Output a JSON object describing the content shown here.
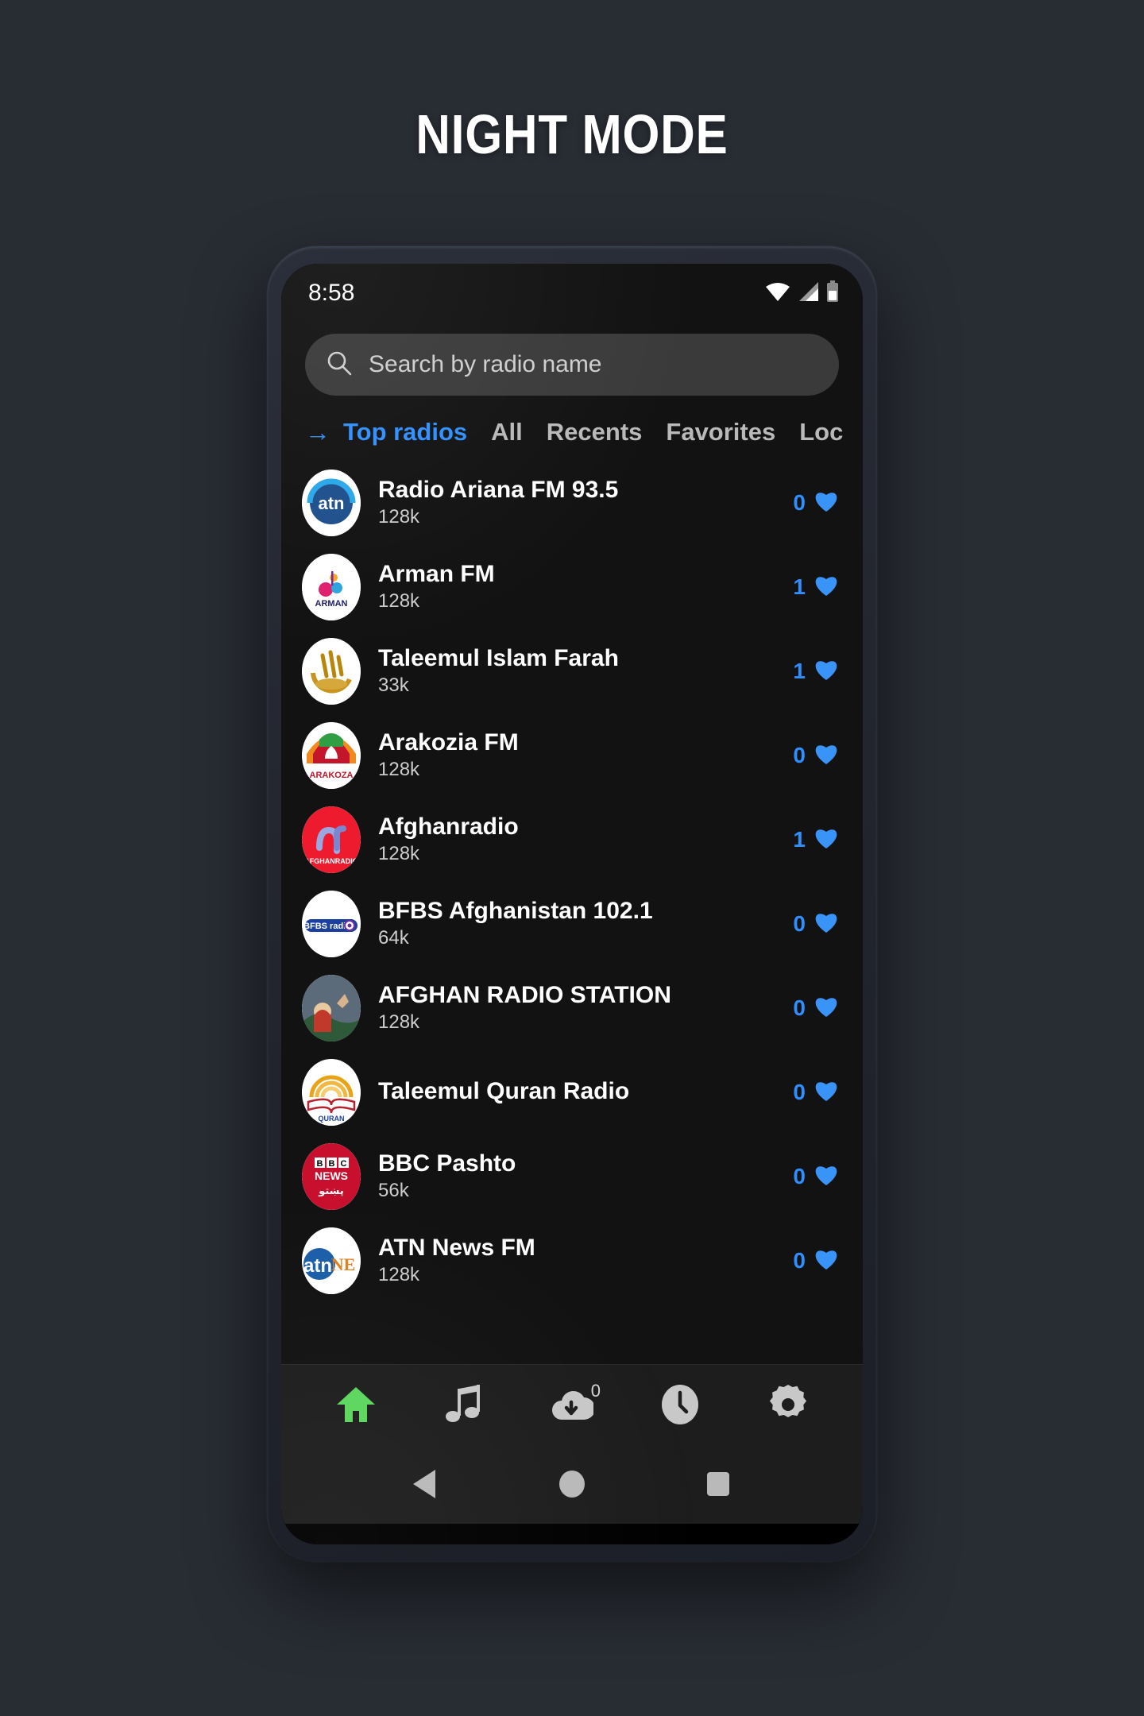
{
  "poster": {
    "title": "NIGHT MODE",
    "background_color": "#282c33"
  },
  "status_bar": {
    "time": "8:58",
    "icons": [
      "wifi-icon",
      "signal-icon",
      "battery-icon"
    ]
  },
  "search": {
    "placeholder": "Search by radio name",
    "icon": "search-icon"
  },
  "tabs": {
    "arrow_glyph": "→",
    "active_color": "#2f8fff",
    "items": [
      {
        "label": "Top radios",
        "active": true
      },
      {
        "label": "All",
        "active": false
      },
      {
        "label": "Recents",
        "active": false
      },
      {
        "label": "Favorites",
        "active": false
      },
      {
        "label": "Loc",
        "active": false
      }
    ]
  },
  "radio_list": [
    {
      "name": "Radio Ariana FM 93.5",
      "bitrate": "128k",
      "favorites": "0",
      "logo": "ariana-logo"
    },
    {
      "name": "Arman FM",
      "bitrate": "128k",
      "favorites": "1",
      "logo": "arman-logo"
    },
    {
      "name": "Taleemul Islam Farah",
      "bitrate": "33k",
      "favorites": "1",
      "logo": "taleemul-islam-logo"
    },
    {
      "name": "Arakozia FM",
      "bitrate": "128k",
      "favorites": "0",
      "logo": "arakozia-logo"
    },
    {
      "name": "Afghanradio",
      "bitrate": "128k",
      "favorites": "1",
      "logo": "afghanradio-logo"
    },
    {
      "name": "BFBS Afghanistan 102.1",
      "bitrate": "64k",
      "favorites": "0",
      "logo": "bfbs-logo"
    },
    {
      "name": "AFGHAN RADIO STATION",
      "bitrate": "128k",
      "favorites": "0",
      "logo": "afghan-radio-station-logo"
    },
    {
      "name": "Taleemul Quran Radio",
      "bitrate": "",
      "favorites": "0",
      "logo": "taleemul-quran-logo"
    },
    {
      "name": "BBC Pashto",
      "bitrate": "56k",
      "favorites": "0",
      "logo": "bbc-pashto-logo"
    },
    {
      "name": "ATN News FM",
      "bitrate": "128k",
      "favorites": "0",
      "logo": "atn-news-logo"
    }
  ],
  "bottom_nav": {
    "items": [
      {
        "icon": "home-icon",
        "active": true,
        "color": "#5cd65c"
      },
      {
        "icon": "music-note-icon",
        "active": false,
        "color": "#c8c8c8"
      },
      {
        "icon": "cloud-download-icon",
        "active": false,
        "color": "#c8c8c8",
        "badge": "0"
      },
      {
        "icon": "clock-icon",
        "active": false,
        "color": "#c8c8c8"
      },
      {
        "icon": "gear-icon",
        "active": false,
        "color": "#c8c8c8"
      }
    ]
  },
  "android_nav": {
    "items": [
      {
        "icon": "back-triangle-icon"
      },
      {
        "icon": "home-circle-icon"
      },
      {
        "icon": "recents-square-icon"
      }
    ]
  },
  "colors": {
    "accent_blue": "#2f8fff",
    "accent_green": "#5cd65c",
    "screen_bg": "#121212",
    "search_bg": "#3a3a3a"
  }
}
